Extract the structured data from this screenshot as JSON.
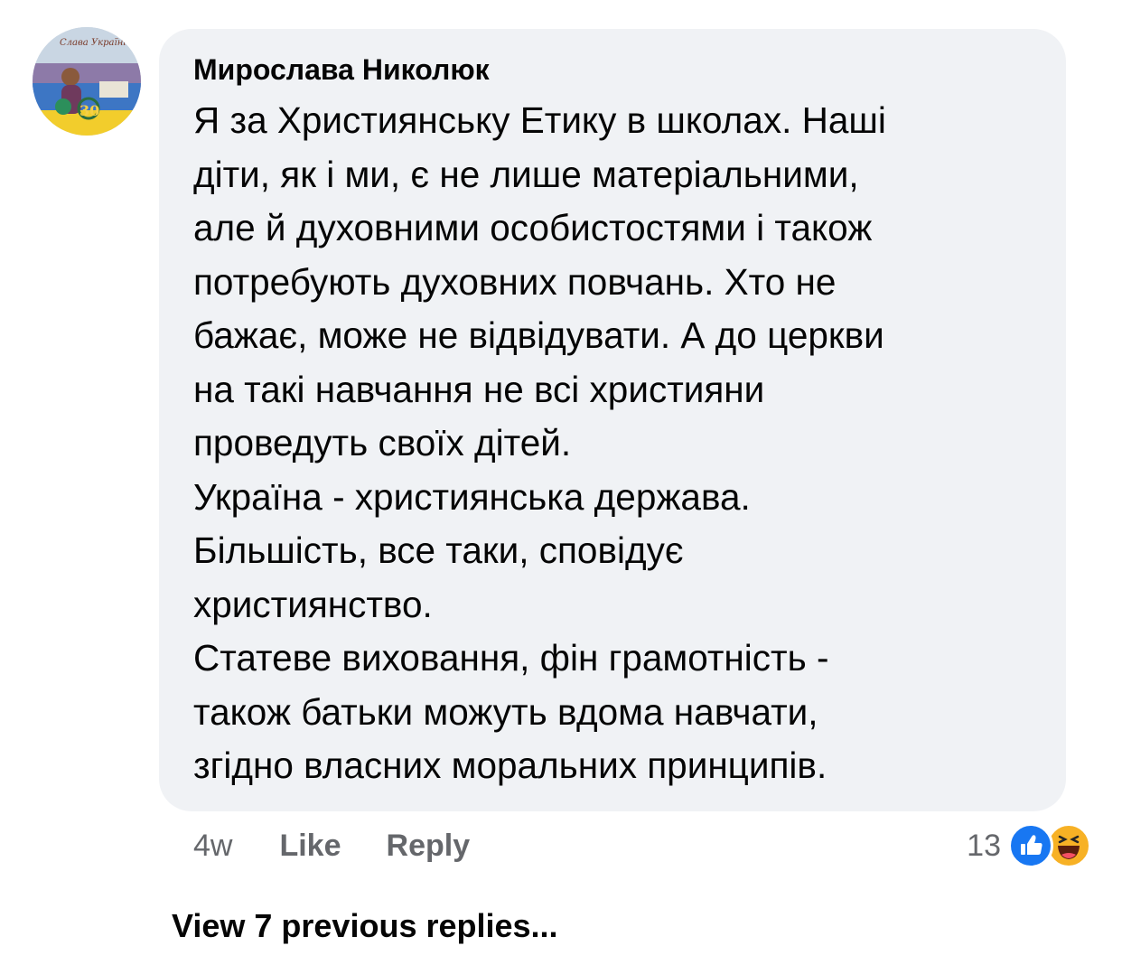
{
  "comment": {
    "author": "Мирослава Николюк",
    "body_lines": [
      "Я за Християнську Етику в школах. Наші",
      "діти, як і ми, є не лише матеріальними,",
      "але й духовними особистостями і також",
      "потребують духовних повчань. Хто не",
      "бажає, може не відвідувати. А до церкви",
      "на такі навчання не всі християни",
      "проведуть своїх дітей.",
      "Україна - християнська держава.",
      "Більшість, все таки, сповідує",
      "християнство.",
      "Статеве виховання, фін грамотність -",
      "також батьки можуть вдома навчати,",
      "згідно власних моральних принципів."
    ],
    "avatar_text": "Слава Україні",
    "avatar_badge": "30"
  },
  "meta": {
    "time": "4w",
    "like_label": "Like",
    "reply_label": "Reply"
  },
  "reactions": {
    "count": "13",
    "icons": [
      "like-icon",
      "haha-icon"
    ]
  },
  "view_previous_label": "View 7 previous replies...",
  "colors": {
    "bubble_bg": "#f0f2f5",
    "meta_text": "#65676b",
    "like_blue": "#1877f2",
    "haha_yellow": "#f7b125"
  }
}
